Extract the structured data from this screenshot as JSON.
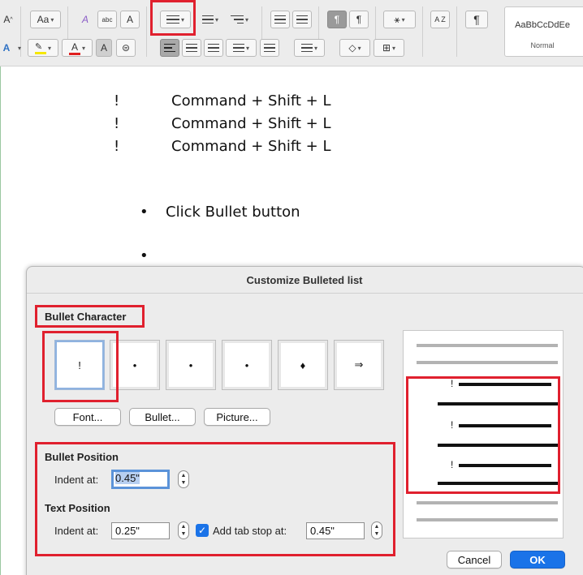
{
  "ribbon": {
    "font_size_grow": "A",
    "change_case": "Aa",
    "clear_format": "A",
    "text_effects": "A",
    "highlight_color": "#f5e700",
    "font_color": "#e02020",
    "char_shading": "A",
    "sort_label": "A Z",
    "pilcrow": "¶",
    "ltr_label": "¶",
    "rtl_label": "¶",
    "style_sample": "AaBbCcDdEe",
    "style_name": "Normal"
  },
  "document": {
    "lines": [
      {
        "bullet": "!",
        "text": "Command + Shift + L"
      },
      {
        "bullet": "!",
        "text": "Command + Shift + L"
      },
      {
        "bullet": "!",
        "text": "Command + Shift + L"
      }
    ],
    "bullet_line": {
      "bullet": "•",
      "text": "Click Bullet button"
    },
    "empty_bullet": "•"
  },
  "dialog": {
    "title": "Customize Bulleted list",
    "bullet_character_label": "Bullet Character",
    "chars": [
      "!",
      "•",
      "•",
      "•",
      "♦",
      "⇒"
    ],
    "buttons": {
      "font": "Font...",
      "bullet": "Bullet...",
      "picture": "Picture..."
    },
    "bullet_position_label": "Bullet Position",
    "bullet_indent_label": "Indent at:",
    "bullet_indent_value": "0.45\"",
    "text_position_label": "Text Position",
    "text_indent_label": "Indent at:",
    "text_indent_value": "0.25\"",
    "tab_stop_label": "Add tab stop at:",
    "tab_stop_value": "0.45\"",
    "preview_bullets": [
      "!",
      "!",
      "!"
    ],
    "cancel": "Cancel",
    "ok": "OK"
  },
  "colors": {
    "highlight": "#e0202e",
    "accent": "#1a73e8"
  }
}
